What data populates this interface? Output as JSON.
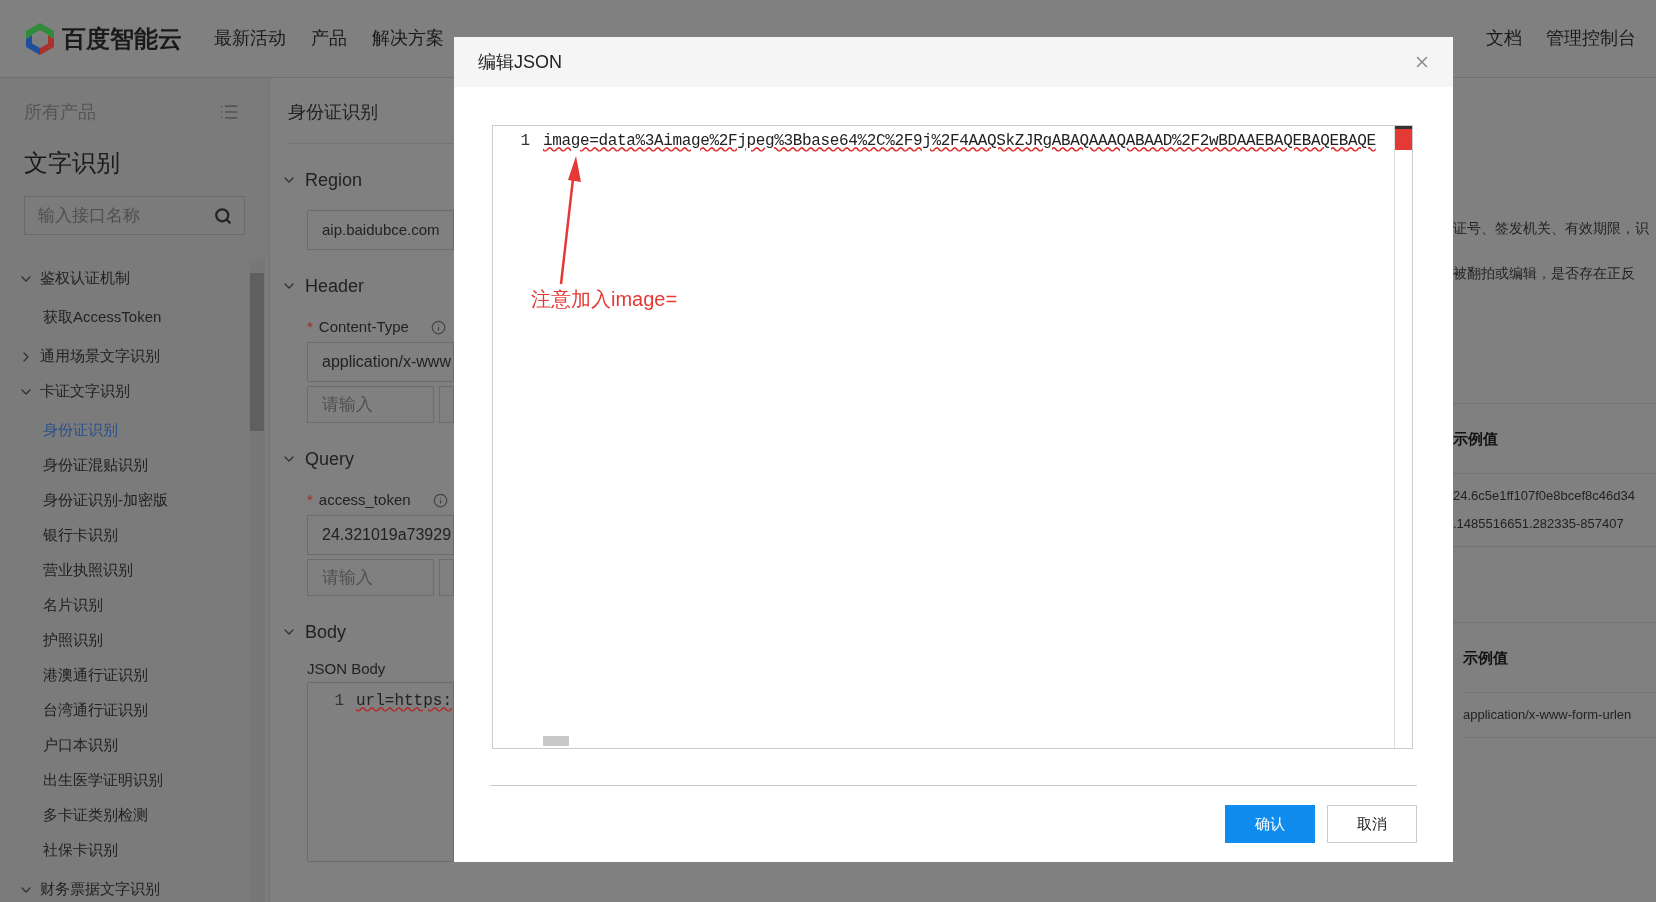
{
  "nav": {
    "logo": "百度智能云",
    "items": [
      {
        "label": "最新活动"
      },
      {
        "label": "产品"
      },
      {
        "label": "解决方案"
      }
    ],
    "right_items": [
      {
        "label": "文档"
      },
      {
        "label": "管理控制台"
      }
    ]
  },
  "sidebar": {
    "header": "所有产品",
    "title": "文字识别",
    "search": {
      "placeholder": "输入接口名称"
    },
    "tree": [
      {
        "label": "鉴权认证机制",
        "expanded": true,
        "children": [
          {
            "label": "获取AccessToken",
            "selected": false
          }
        ]
      },
      {
        "label": "通用场景文字识别",
        "expanded": false
      },
      {
        "label": "卡证文字识别",
        "expanded": true,
        "children": [
          {
            "label": "身份证识别",
            "selected": true
          },
          {
            "label": "身份证混贴识别",
            "selected": false
          },
          {
            "label": "身份证识别-加密版",
            "selected": false
          },
          {
            "label": "银行卡识别",
            "selected": false
          },
          {
            "label": "营业执照识别",
            "selected": false
          },
          {
            "label": "名片识别",
            "selected": false
          },
          {
            "label": "护照识别",
            "selected": false
          },
          {
            "label": "港澳通行证识别",
            "selected": false
          },
          {
            "label": "台湾通行证识别",
            "selected": false
          },
          {
            "label": "户口本识别",
            "selected": false
          },
          {
            "label": "出生医学证明识别",
            "selected": false
          },
          {
            "label": "多卡证类别检测",
            "selected": false
          },
          {
            "label": "社保卡识别",
            "selected": false
          }
        ]
      },
      {
        "label": "财务票据文字识别",
        "expanded": true
      }
    ]
  },
  "api_panel": {
    "title": "身份证识别",
    "sections": [
      {
        "title": "Region",
        "expanded": true,
        "kind": "region",
        "value": "aip.baidubce.com"
      },
      {
        "title": "Header",
        "expanded": true,
        "kind": "params",
        "param": {
          "name": "Content-Type",
          "required_mark": "*",
          "value": "application/x-www"
        },
        "new_key": {
          "placeholder": "请输入"
        }
      },
      {
        "title": "Query",
        "expanded": true,
        "kind": "params",
        "param": {
          "name": "access_token",
          "required_mark": "*",
          "value": "24.321019a73929"
        },
        "new_key": {
          "placeholder": "请输入"
        }
      },
      {
        "title": "Body",
        "expanded": true,
        "kind": "body",
        "label": "JSON Body",
        "line_number": "1",
        "code": "url=https:"
      }
    ]
  },
  "right_content": {
    "description_lines": [
      "证号、签发机关、有效期限，识",
      "被翻拍或编辑，是否存在正反"
    ],
    "tables": [
      {
        "header": "示例值",
        "rows": [
          "24.6c5e1ff107f0e8bcef8c46d34",
          ".1485516651.282335-857407"
        ]
      },
      {
        "header": "示例值",
        "rows": [
          "application/x-www-form-urlen"
        ]
      }
    ]
  },
  "modal": {
    "title": "编辑JSON",
    "editor": {
      "line_number": "1",
      "code": "image=data%3Aimage%2Fjpeg%3Bbase64%2C%2F9j%2F4AAQSkZJRgABAQAAAQABAAD%2F2wBDAAEBAQEBAQEBAQE"
    },
    "annotation": "注意加入image=",
    "buttons": [
      {
        "label": "确认",
        "kind": "primary"
      },
      {
        "label": "取消",
        "kind": "secondary"
      }
    ]
  }
}
